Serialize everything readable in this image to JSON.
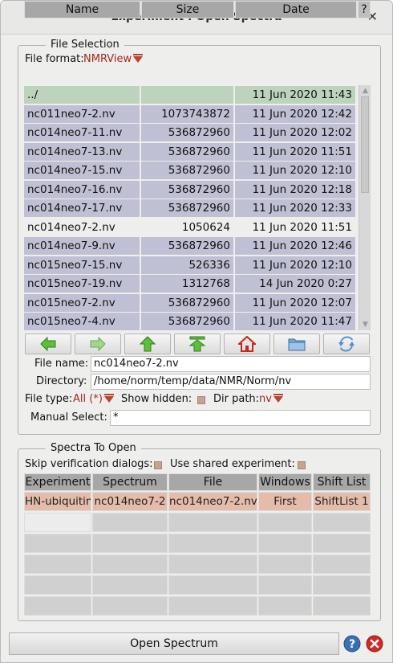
{
  "window": {
    "title": "Experiment : Open Spectra",
    "close_glyph": "✕"
  },
  "file_selection": {
    "legend": "File Selection",
    "file_format_label": "File format:",
    "file_format_value": "NMRView",
    "columns": [
      "Name",
      "Size",
      "Date"
    ],
    "corner_label": "?",
    "rows": [
      {
        "name": "../",
        "size": "",
        "date": "11 Jun 2020 11:43",
        "kind": "parent"
      },
      {
        "name": "nc011neo7-2.nv",
        "size": "1073743872",
        "date": "11 Jun 2020 12:42",
        "kind": "normal"
      },
      {
        "name": "nc014neo7-11.nv",
        "size": "536872960",
        "date": "11 Jun 2020 12:02",
        "kind": "normal"
      },
      {
        "name": "nc014neo7-13.nv",
        "size": "536872960",
        "date": "11 Jun 2020 11:51",
        "kind": "normal"
      },
      {
        "name": "nc014neo7-15.nv",
        "size": "536872960",
        "date": "11 Jun 2020 12:10",
        "kind": "normal"
      },
      {
        "name": "nc014neo7-16.nv",
        "size": "536872960",
        "date": "11 Jun 2020 12:18",
        "kind": "normal"
      },
      {
        "name": "nc014neo7-17.nv",
        "size": "536872960",
        "date": "11 Jun 2020 12:33",
        "kind": "normal"
      },
      {
        "name": "nc014neo7-2.nv",
        "size": "1050624",
        "date": "11 Jun 2020 11:51",
        "kind": "selected"
      },
      {
        "name": "nc014neo7-9.nv",
        "size": "536872960",
        "date": "11 Jun 2020 12:46",
        "kind": "normal"
      },
      {
        "name": "nc015neo7-15.nv",
        "size": "526336",
        "date": "11 Jun 2020 12:10",
        "kind": "normal"
      },
      {
        "name": "nc015neo7-19.nv",
        "size": "1312768",
        "date": "14 Jun 2020  0:27",
        "kind": "normal"
      },
      {
        "name": "nc015neo7-2.nv",
        "size": "536872960",
        "date": "11 Jun 2020 12:07",
        "kind": "normal"
      },
      {
        "name": "nc015neo7-4.nv",
        "size": "536872960",
        "date": "11 Jun 2020 11:47",
        "kind": "normal"
      }
    ],
    "nav_buttons": [
      "back-arrow-icon",
      "forward-arrow-icon",
      "up-arrow-icon",
      "top-arrow-icon",
      "home-icon",
      "folder-icon",
      "refresh-icon"
    ],
    "file_name_label": "File name:",
    "file_name_value": "nc014neo7-2.nv",
    "directory_label": "Directory:",
    "directory_value": "/home/norm/temp/data/NMR/Norm/nv",
    "file_type_label": "File type:",
    "file_type_value": "All (*)",
    "show_hidden_label": "Show hidden:",
    "dir_path_label": "Dir path:",
    "dir_path_value": "nv",
    "manual_select_label": "Manual Select:",
    "manual_select_value": "*"
  },
  "spectra": {
    "legend": "Spectra To Open",
    "skip_verification_label": "Skip verification dialogs:",
    "use_shared_label": "Use shared experiment:",
    "columns": [
      "Experiment",
      "Spectrum",
      "File",
      "Windows",
      "Shift List"
    ],
    "row": [
      "HN-ubiquitin",
      "nc014neo7-2",
      "nc014neo7-2.nv",
      "First",
      "ShiftList 1"
    ]
  },
  "footer": {
    "open_label": "Open Spectrum",
    "help_glyph": "?",
    "close_glyph": "✕"
  },
  "colors": {
    "row_normal": "#c0c0d4",
    "row_parent": "#bcd3bc",
    "row_selected": "#33342c",
    "accent_red": "#a12a1a",
    "spectra_row": "#e5bcaa"
  }
}
